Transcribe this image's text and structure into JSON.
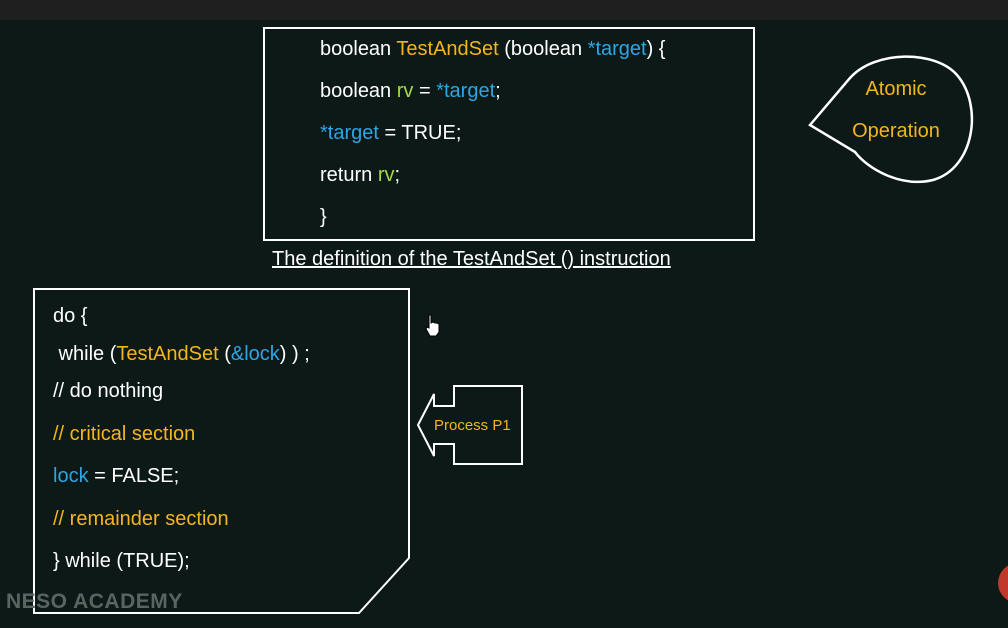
{
  "definition": {
    "line1": {
      "kw": "boolean ",
      "fn": "TestAndSet",
      "mid": " (boolean ",
      "var": "*target",
      "end": ") {"
    },
    "line2": {
      "kw": "boolean ",
      "rv": "rv",
      "mid": " = ",
      "var": "*target",
      "end": ";"
    },
    "line3": {
      "var": "*target",
      "end": " = TRUE;"
    },
    "line4": {
      "kw": "return ",
      "rv": "rv",
      "end": ";"
    },
    "line5": "}",
    "caption": "The definition of the TestAndSet () instruction"
  },
  "bubble": {
    "line1": "Atomic",
    "line2": "Operation"
  },
  "loop": {
    "line1": "do {",
    "line2": {
      "pre": " while (",
      "fn": "TestAndSet",
      "mid": " (",
      "var": "&lock",
      "end": ") ) ;"
    },
    "line3": "// do nothing",
    "line4": "// critical section",
    "line5": {
      "var": "lock",
      "end": " = FALSE;"
    },
    "line6": "// remainder section",
    "line7": "} while (TRUE);"
  },
  "process_label": "Process P1",
  "watermark": "NESO ACADEMY",
  "colors": {
    "background": "#0c1916",
    "keyword": "#ffffff",
    "function": "#f4b51f",
    "variable": "#2ea6e6",
    "return_var": "#a8d848"
  }
}
